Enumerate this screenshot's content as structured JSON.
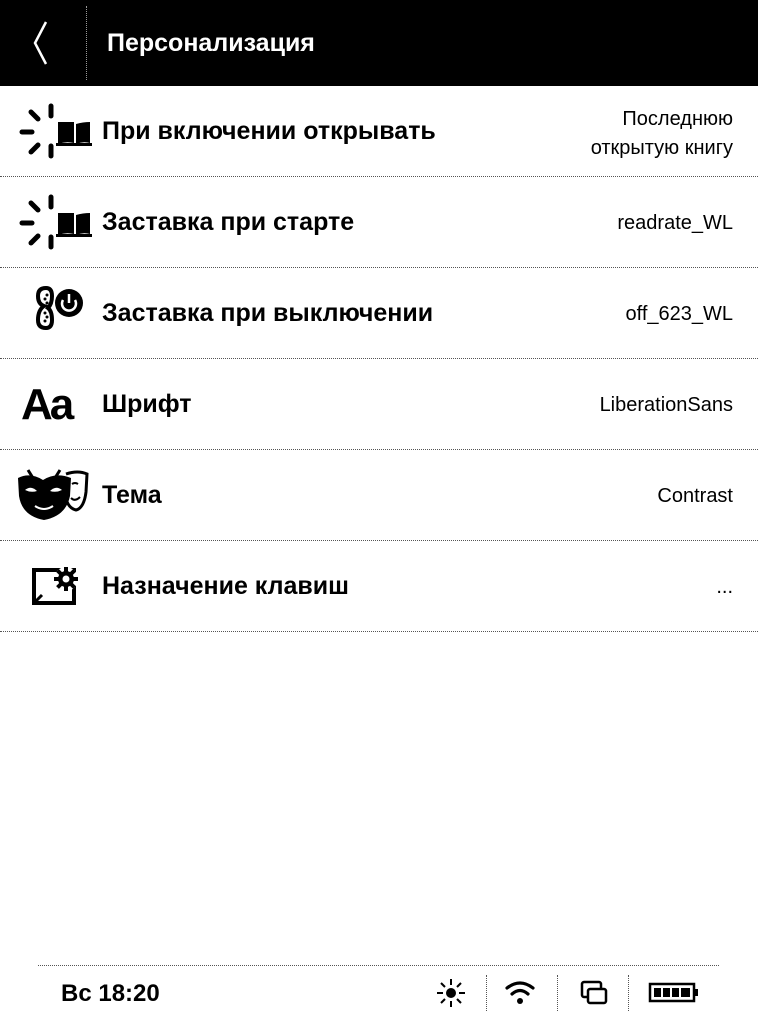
{
  "header": {
    "title": "Персонализация"
  },
  "items": [
    {
      "label": "При включении открывать",
      "value": "Последнюю\nоткрытую книгу"
    },
    {
      "label": "Заставка при старте",
      "value": "readrate_WL"
    },
    {
      "label": "Заставка при выключении",
      "value": "off_623_WL"
    },
    {
      "label": "Шрифт",
      "value": "LiberationSans"
    },
    {
      "label": "Тема",
      "value": "Contrast"
    },
    {
      "label": "Назначение клавиш",
      "value": "..."
    }
  ],
  "status": {
    "time": "Вс 18:20",
    "battery_level": 1.0
  }
}
